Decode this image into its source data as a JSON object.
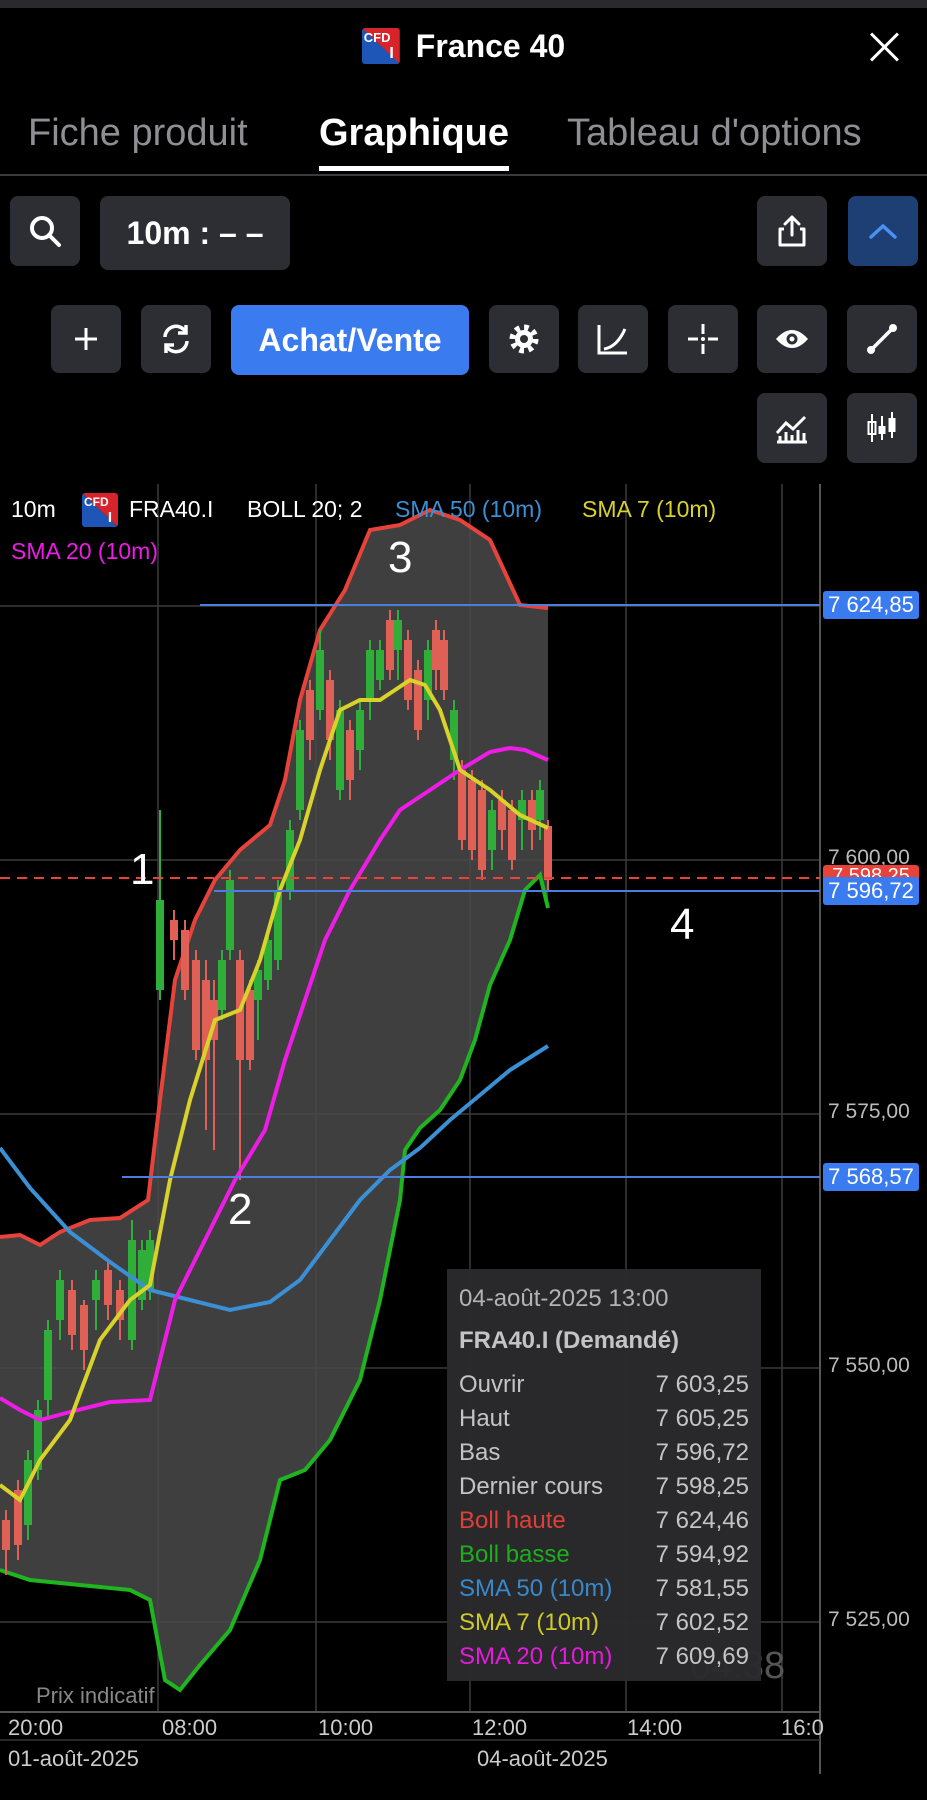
{
  "header": {
    "title": "France 40",
    "logo_text": "CFD",
    "logo_sub": "I"
  },
  "tabs": [
    {
      "label": "Fiche produit"
    },
    {
      "label": "Graphique"
    },
    {
      "label": "Tableau d'options"
    }
  ],
  "toolbar": {
    "timeframe_label": "10m : – –",
    "achat_label": "Achat/Vente"
  },
  "chart_legend": {
    "interval": "10m",
    "symbol": "FRA40.I",
    "boll": "BOLL 20; 2",
    "sma50": "SMA 50 (10m)",
    "sma7": "SMA 7 (10m)",
    "sma20": "SMA 20 (10m)"
  },
  "colors": {
    "boll_upper": "#e8433a",
    "boll_lower": "#1fb51f",
    "sma50": "#3b8fd4",
    "sma7": "#d8d22a",
    "sma20": "#ee1ce6",
    "level_line": "#4a7fe0",
    "price_line": "#e8433a",
    "bull": "#2fae3a",
    "bear": "#e06055"
  },
  "price_tags": {
    "upper": "7 624,85",
    "current": "7 598,25",
    "current_low": "7 596,72",
    "lower": "7 568,57"
  },
  "y_axis": [
    "7 600,00",
    "7 575,00",
    "7 550,00",
    "7 525,00"
  ],
  "x_axis": [
    "20:00",
    "08:00",
    "10:00",
    "12:00",
    "14:00",
    "16:0"
  ],
  "dates": [
    "01-août-2025",
    "04-août-2025"
  ],
  "annotations": [
    "1",
    "2",
    "3",
    "4"
  ],
  "watermark": "Prix indicatif",
  "countdown": "04:38",
  "tooltip": {
    "datetime": "04-août-2025 13:00",
    "instrument": "FRA40.I (Demandé)",
    "rows": [
      {
        "label": "Ouvrir",
        "value": "7 603,25"
      },
      {
        "label": "Haut",
        "value": "7 605,25"
      },
      {
        "label": "Bas",
        "value": "7 596,72"
      },
      {
        "label": "Dernier cours",
        "value": "7 598,25"
      },
      {
        "label": "Boll haute",
        "value": "7 624,46"
      },
      {
        "label": "Boll basse",
        "value": "7 594,92"
      },
      {
        "label": "SMA 50 (10m)",
        "value": "7 581,55"
      },
      {
        "label": "SMA 7 (10m)",
        "value": "7 602,52"
      },
      {
        "label": "SMA 20 (10m)",
        "value": "7 609,69"
      }
    ]
  },
  "chart_data": {
    "type": "line",
    "symbol": "FRA40.I",
    "ylim": [
      7515,
      7640
    ],
    "series": [
      {
        "name": "BOLL 20; 2",
        "values": []
      },
      {
        "name": "SMA 50 (10m)",
        "values": []
      },
      {
        "name": "SMA 7 (10m)",
        "values": []
      },
      {
        "name": "SMA 20 (10m)",
        "values": []
      }
    ],
    "horizontal_levels": [
      7624.85,
      7596.72,
      7568.57
    ],
    "last_price": 7598.25,
    "grid": true
  }
}
